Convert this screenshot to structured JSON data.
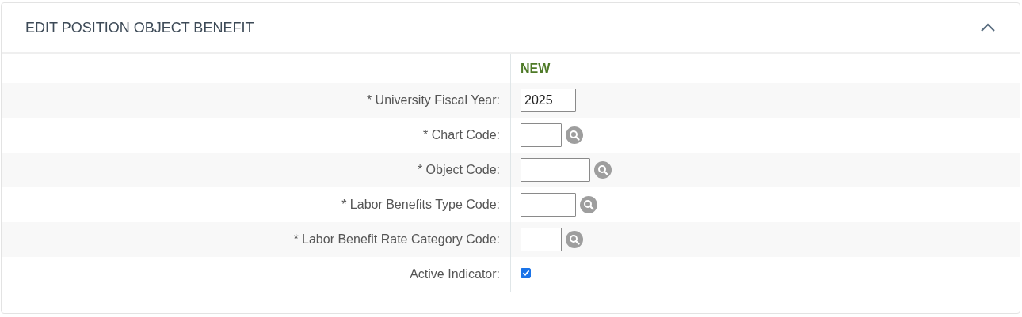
{
  "panel": {
    "title": "EDIT POSITION OBJECT BENEFIT",
    "expanded": true
  },
  "column_header": "NEW",
  "rows": [
    {
      "label": "* University Fiscal Year:",
      "kind": "text",
      "value": "2025"
    },
    {
      "label": "* Chart Code:",
      "kind": "lookup"
    },
    {
      "label": "* Object Code:",
      "kind": "lookup"
    },
    {
      "label": "* Labor Benefits Type Code:",
      "kind": "lookup"
    },
    {
      "label": "* Labor Benefit Rate Category Code:",
      "kind": "lookup"
    },
    {
      "label": "Active Indicator:",
      "kind": "checkbox",
      "checked": true
    }
  ]
}
